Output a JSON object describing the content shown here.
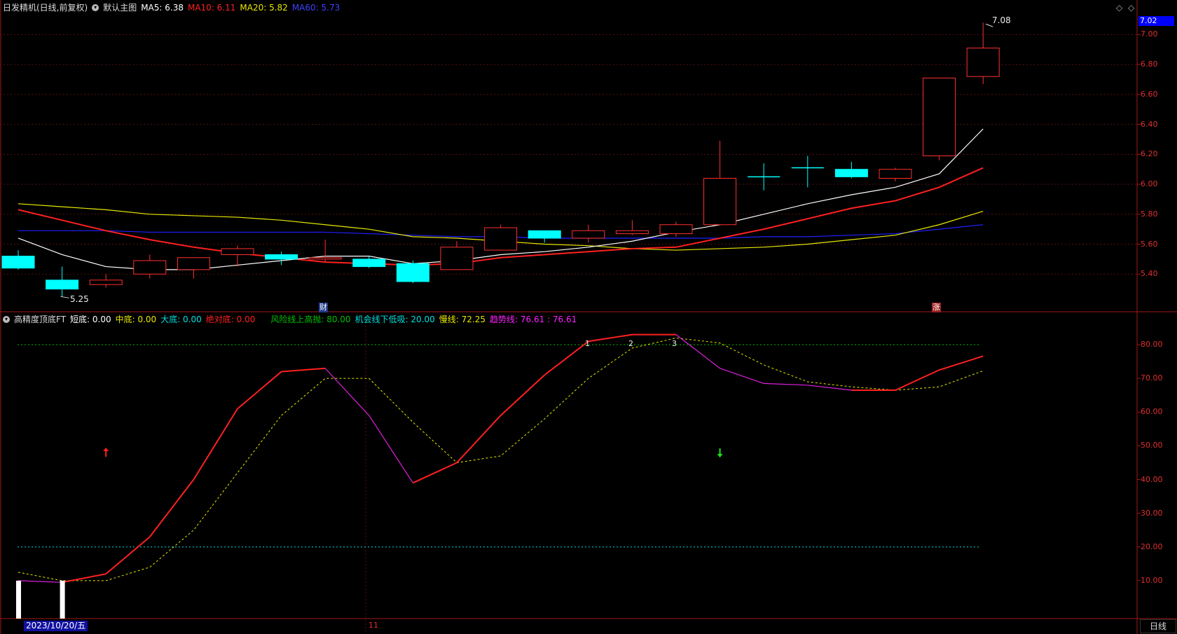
{
  "header": {
    "stock_title": "日发精机(日线,前复权)",
    "main_chart_label": "默认主图",
    "ma5": "MA5: 6.38",
    "ma10": "MA10: 6.11",
    "ma20": "MA20: 5.82",
    "ma60": "MA60: 5.73",
    "colors": {
      "ma5": "#ffffff",
      "ma10": "#ff2020",
      "ma20": "#e8e800",
      "ma60": "#2020ff"
    }
  },
  "indicator_header": {
    "name": "高精度顶底FT",
    "items": [
      {
        "text": "短底: 0.00",
        "color": "#ffffff"
      },
      {
        "text": "中底: 0.00",
        "color": "#e8e800"
      },
      {
        "text": "大底: 0.00",
        "color": "#00e0e0"
      },
      {
        "text": "绝对底: 0.00",
        "color": "#ff2020"
      },
      {
        "text": "风险线上高抛: 80.00",
        "color": "#00c000"
      },
      {
        "text": "机会线下低吸: 20.00",
        "color": "#00e0e0"
      },
      {
        "text": "慢线: 72.25",
        "color": "#e8e800"
      },
      {
        "text": "趋势线: 76.61 : 76.61",
        "color": "#ff20ff"
      }
    ]
  },
  "price_axis": {
    "current_price": "7.02",
    "ticks": [
      "7.00",
      "6.80",
      "6.60",
      "6.40",
      "6.20",
      "6.00",
      "5.80",
      "5.60",
      "5.40"
    ]
  },
  "indicator_axis": {
    "ticks": [
      "80.00",
      "70.00",
      "60.00",
      "50.00",
      "40.00",
      "30.00",
      "20.00",
      "10.00"
    ]
  },
  "annotations": {
    "high_label": "7.08",
    "low_label": "5.25",
    "cai_marker": "财",
    "zhang_marker": "涨",
    "wave_labels": [
      "1",
      "2",
      "3"
    ],
    "month_label": "11",
    "date_label": "2023/10/20/五",
    "period_button": "日线",
    "window_controls": [
      "◇",
      "◇"
    ]
  },
  "chart_data": {
    "type": "candlestick",
    "candles": [
      {
        "o": 5.44,
        "c": 5.52,
        "h": 5.56,
        "l": 5.43,
        "up": false
      },
      {
        "o": 5.36,
        "c": 5.3,
        "h": 5.45,
        "l": 5.25,
        "up": false
      },
      {
        "o": 5.33,
        "c": 5.36,
        "h": 5.4,
        "l": 5.31,
        "up": true
      },
      {
        "o": 5.4,
        "c": 5.49,
        "h": 5.53,
        "l": 5.37,
        "up": true
      },
      {
        "o": 5.43,
        "c": 5.51,
        "h": 5.51,
        "l": 5.37,
        "up": true
      },
      {
        "o": 5.53,
        "c": 5.57,
        "h": 5.59,
        "l": 5.45,
        "up": true
      },
      {
        "o": 5.53,
        "c": 5.5,
        "h": 5.55,
        "l": 5.46,
        "up": false
      },
      {
        "o": 5.5,
        "c": 5.51,
        "h": 5.63,
        "l": 5.48,
        "up": true
      },
      {
        "o": 5.5,
        "c": 5.45,
        "h": 5.52,
        "l": 5.44,
        "up": false
      },
      {
        "o": 5.47,
        "c": 5.35,
        "h": 5.49,
        "l": 5.34,
        "up": false
      },
      {
        "o": 5.43,
        "c": 5.58,
        "h": 5.62,
        "l": 5.43,
        "up": true
      },
      {
        "o": 5.56,
        "c": 5.71,
        "h": 5.73,
        "l": 5.56,
        "up": true
      },
      {
        "o": 5.69,
        "c": 5.64,
        "h": 5.69,
        "l": 5.61,
        "up": false
      },
      {
        "o": 5.64,
        "c": 5.69,
        "h": 5.73,
        "l": 5.61,
        "up": true
      },
      {
        "o": 5.67,
        "c": 5.69,
        "h": 5.76,
        "l": 5.66,
        "up": true
      },
      {
        "o": 5.67,
        "c": 5.73,
        "h": 5.75,
        "l": 5.65,
        "up": true
      },
      {
        "o": 5.73,
        "c": 6.04,
        "h": 6.29,
        "l": 5.73,
        "up": true
      },
      {
        "o": 6.05,
        "c": 6.05,
        "h": 6.14,
        "l": 5.96,
        "up": false
      },
      {
        "o": 6.11,
        "c": 6.11,
        "h": 6.19,
        "l": 5.98,
        "up": false
      },
      {
        "o": 6.1,
        "c": 6.05,
        "h": 6.15,
        "l": 6.04,
        "up": false
      },
      {
        "o": 6.04,
        "c": 6.1,
        "h": 6.11,
        "l": 6.02,
        "up": true
      },
      {
        "o": 6.19,
        "c": 6.71,
        "h": 6.71,
        "l": 6.16,
        "up": true
      },
      {
        "o": 6.72,
        "c": 6.91,
        "h": 7.08,
        "l": 6.67,
        "up": true
      }
    ],
    "ma5": [
      5.64,
      5.53,
      5.45,
      5.43,
      5.43,
      5.46,
      5.49,
      5.52,
      5.52,
      5.47,
      5.49,
      5.53,
      5.55,
      5.58,
      5.62,
      5.68,
      5.73,
      5.8,
      5.87,
      5.93,
      5.98,
      6.07,
      6.37
    ],
    "ma10": [
      5.83,
      5.76,
      5.69,
      5.63,
      5.58,
      5.54,
      5.51,
      5.48,
      5.47,
      5.46,
      5.47,
      5.51,
      5.53,
      5.55,
      5.57,
      5.58,
      5.64,
      5.7,
      5.77,
      5.84,
      5.89,
      5.98,
      6.11
    ],
    "ma20": [
      5.87,
      5.85,
      5.83,
      5.8,
      5.79,
      5.78,
      5.76,
      5.73,
      5.7,
      5.65,
      5.64,
      5.62,
      5.6,
      5.59,
      5.57,
      5.56,
      5.57,
      5.58,
      5.6,
      5.63,
      5.66,
      5.73,
      5.82
    ],
    "ma60": [
      5.69,
      5.69,
      5.69,
      5.68,
      5.68,
      5.68,
      5.68,
      5.68,
      5.67,
      5.66,
      5.65,
      5.65,
      5.64,
      5.64,
      5.64,
      5.64,
      5.64,
      5.65,
      5.65,
      5.66,
      5.67,
      5.7,
      5.73
    ],
    "price_ylim": [
      5.2,
      7.1
    ],
    "indicator": {
      "ylim": [
        0,
        85
      ],
      "risk_line": 80,
      "chance_line": 20,
      "trend": [
        10,
        9.5,
        12,
        23,
        40,
        61,
        72,
        73,
        59,
        39,
        45,
        59,
        71,
        81,
        83,
        83,
        73,
        68.5,
        68,
        66.5,
        66.5,
        72.5,
        76.61
      ],
      "slow": [
        12.5,
        10,
        10,
        14,
        25,
        42,
        59,
        70,
        70,
        57,
        45,
        47,
        58,
        70,
        79,
        82,
        80.5,
        74,
        69,
        67.5,
        66.5,
        67.5,
        72.25
      ],
      "trend_up_color": "#ff2020",
      "trend_down_color": "#e020e0",
      "bars": [
        1,
        1
      ],
      "up_arrow_index": 2,
      "down_arrow_index": 16
    }
  }
}
